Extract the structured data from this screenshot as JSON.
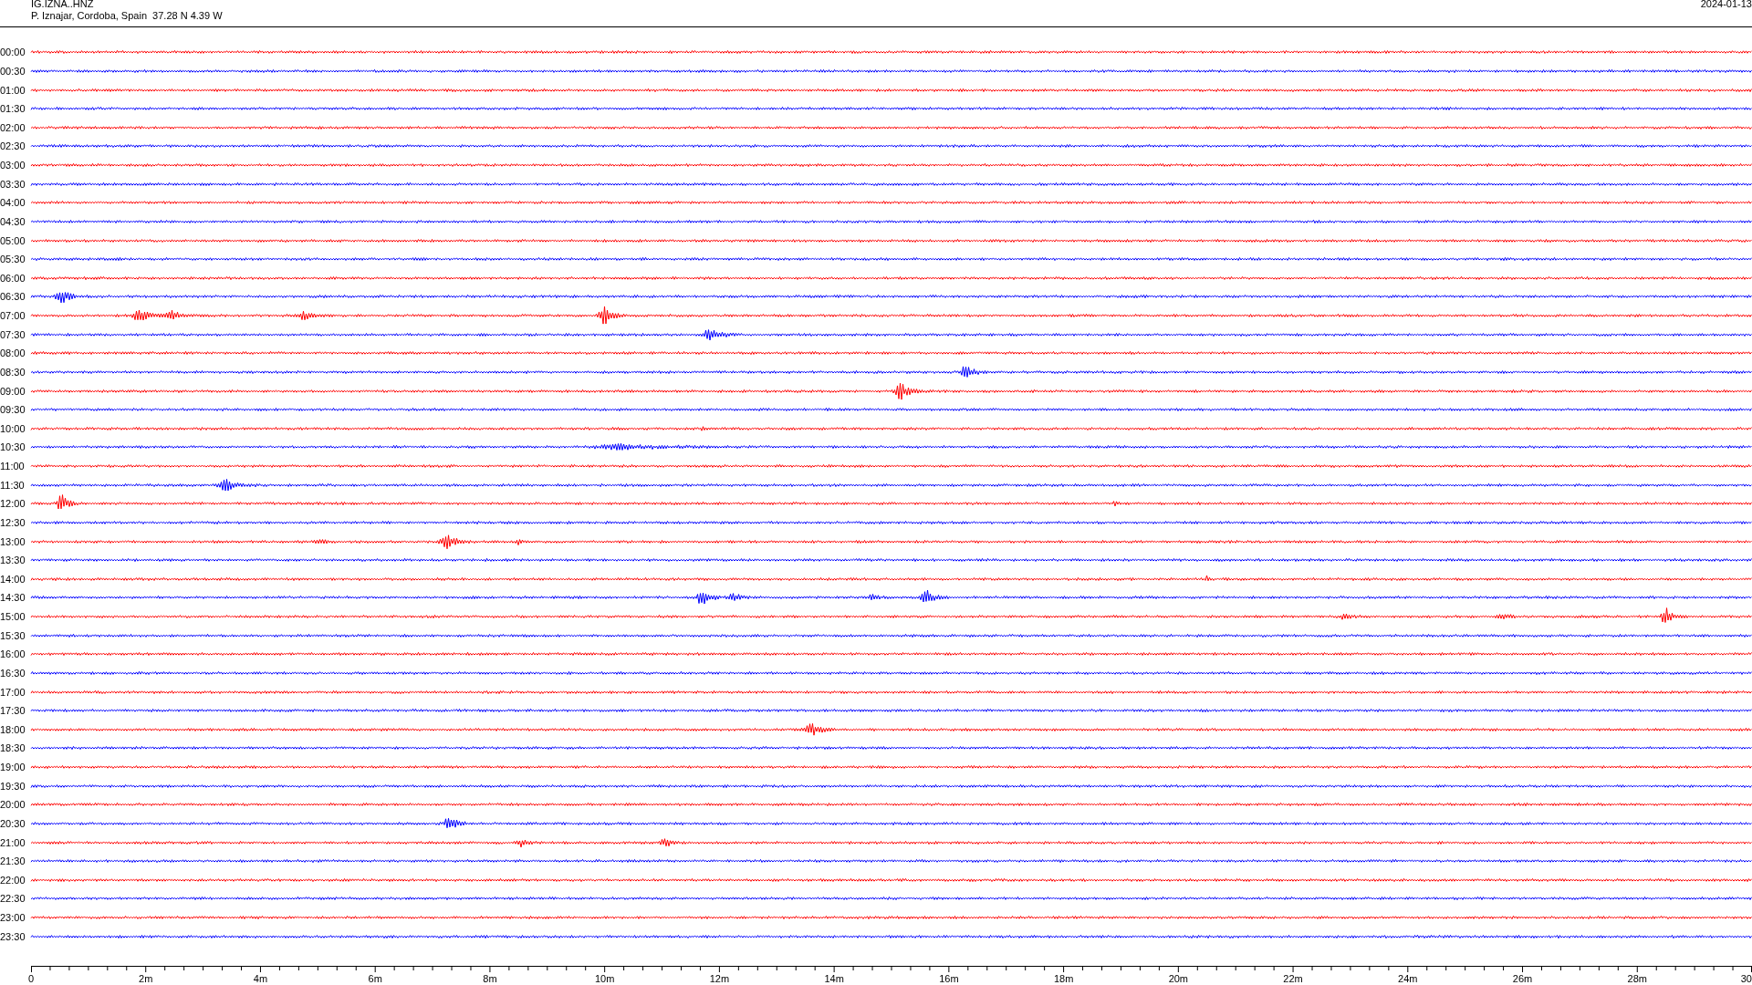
{
  "header": {
    "station": "IG.IZNA..HNZ",
    "location": "P. Iznajar, Cordoba, Spain  37.28 N 4.39 W",
    "date": "2024-01-13"
  },
  "traces": [
    {
      "time": "00:00",
      "color": "#ff0000"
    },
    {
      "time": "00:30",
      "color": "#0000ff"
    },
    {
      "time": "01:00",
      "color": "#ff0000"
    },
    {
      "time": "01:30",
      "color": "#0000ff"
    },
    {
      "time": "02:00",
      "color": "#ff0000"
    },
    {
      "time": "02:30",
      "color": "#0000ff"
    },
    {
      "time": "03:00",
      "color": "#ff0000"
    },
    {
      "time": "03:30",
      "color": "#0000ff"
    },
    {
      "time": "04:00",
      "color": "#ff0000"
    },
    {
      "time": "04:30",
      "color": "#0000ff"
    },
    {
      "time": "05:00",
      "color": "#ff0000"
    },
    {
      "time": "05:30",
      "color": "#0000ff"
    },
    {
      "time": "06:00",
      "color": "#ff0000"
    },
    {
      "time": "06:30",
      "color": "#0000ff"
    },
    {
      "time": "07:00",
      "color": "#ff0000"
    },
    {
      "time": "07:30",
      "color": "#0000ff"
    },
    {
      "time": "08:00",
      "color": "#ff0000"
    },
    {
      "time": "08:30",
      "color": "#0000ff"
    },
    {
      "time": "09:00",
      "color": "#ff0000"
    },
    {
      "time": "09:30",
      "color": "#0000ff"
    },
    {
      "time": "10:00",
      "color": "#ff0000"
    },
    {
      "time": "10:30",
      "color": "#0000ff"
    },
    {
      "time": "11:00",
      "color": "#ff0000"
    },
    {
      "time": "11:30",
      "color": "#0000ff"
    },
    {
      "time": "12:00",
      "color": "#ff0000"
    },
    {
      "time": "12:30",
      "color": "#0000ff"
    },
    {
      "time": "13:00",
      "color": "#ff0000"
    },
    {
      "time": "13:30",
      "color": "#0000ff"
    },
    {
      "time": "14:00",
      "color": "#ff0000"
    },
    {
      "time": "14:30",
      "color": "#0000ff"
    },
    {
      "time": "15:00",
      "color": "#ff0000"
    },
    {
      "time": "15:30",
      "color": "#0000ff"
    },
    {
      "time": "16:00",
      "color": "#ff0000"
    },
    {
      "time": "16:30",
      "color": "#0000ff"
    },
    {
      "time": "17:00",
      "color": "#ff0000"
    },
    {
      "time": "17:30",
      "color": "#0000ff"
    },
    {
      "time": "18:00",
      "color": "#ff0000"
    },
    {
      "time": "18:30",
      "color": "#0000ff"
    },
    {
      "time": "19:00",
      "color": "#ff0000"
    },
    {
      "time": "19:30",
      "color": "#0000ff"
    },
    {
      "time": "20:00",
      "color": "#ff0000"
    },
    {
      "time": "20:30",
      "color": "#0000ff"
    },
    {
      "time": "21:00",
      "color": "#ff0000"
    },
    {
      "time": "21:30",
      "color": "#0000ff"
    },
    {
      "time": "22:00",
      "color": "#ff0000"
    },
    {
      "time": "22:30",
      "color": "#0000ff"
    },
    {
      "time": "23:00",
      "color": "#ff0000"
    },
    {
      "time": "23:30",
      "color": "#0000ff"
    }
  ],
  "x_axis": {
    "labels": [
      "0",
      "2m",
      "4m",
      "6m",
      "8m",
      "10m",
      "12m",
      "14m",
      "16m",
      "18m",
      "20m",
      "22m",
      "24m",
      "26m",
      "28m",
      "30"
    ]
  }
}
